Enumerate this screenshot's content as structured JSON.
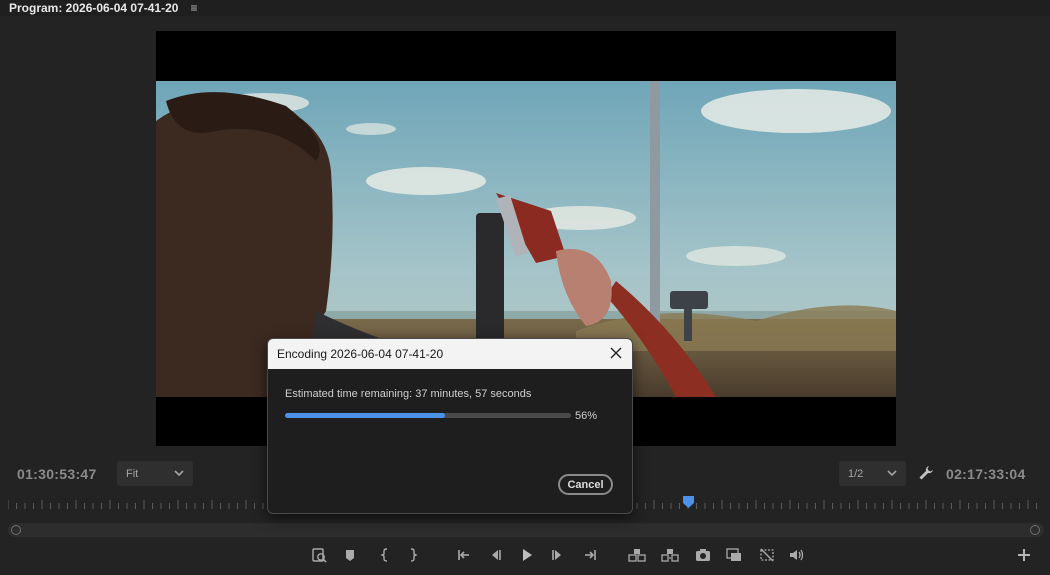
{
  "panel": {
    "title": "Program: 2026-06-04 07-41-20",
    "menu_glyph": "≡"
  },
  "monitor": {
    "timecode_left": "01:30:53:47",
    "timecode_right": "02:17:33:04",
    "zoom_dropdown": "Fit",
    "resolution_dropdown": "1/2"
  },
  "transport_icons": [
    "export-frame-icon",
    "add-marker-icon",
    "mark-in-icon",
    "mark-out-icon",
    "go-to-in-icon",
    "step-back-icon",
    "play-icon",
    "step-forward-icon",
    "go-to-out-icon",
    "lift-icon",
    "extract-icon",
    "camera-icon",
    "comparison-view-icon",
    "safe-margins-icon",
    "volume-icon",
    "add-button-icon"
  ],
  "dialog": {
    "title": "Encoding 2026-06-04 07-41-20",
    "message": "Estimated time remaining: 37 minutes, 57 seconds",
    "progress_percent": 56,
    "progress_label": "56%",
    "cancel_label": "Cancel"
  },
  "colors": {
    "accent": "#4c92e8",
    "playhead": "#4c92e8",
    "background": "#232323"
  }
}
